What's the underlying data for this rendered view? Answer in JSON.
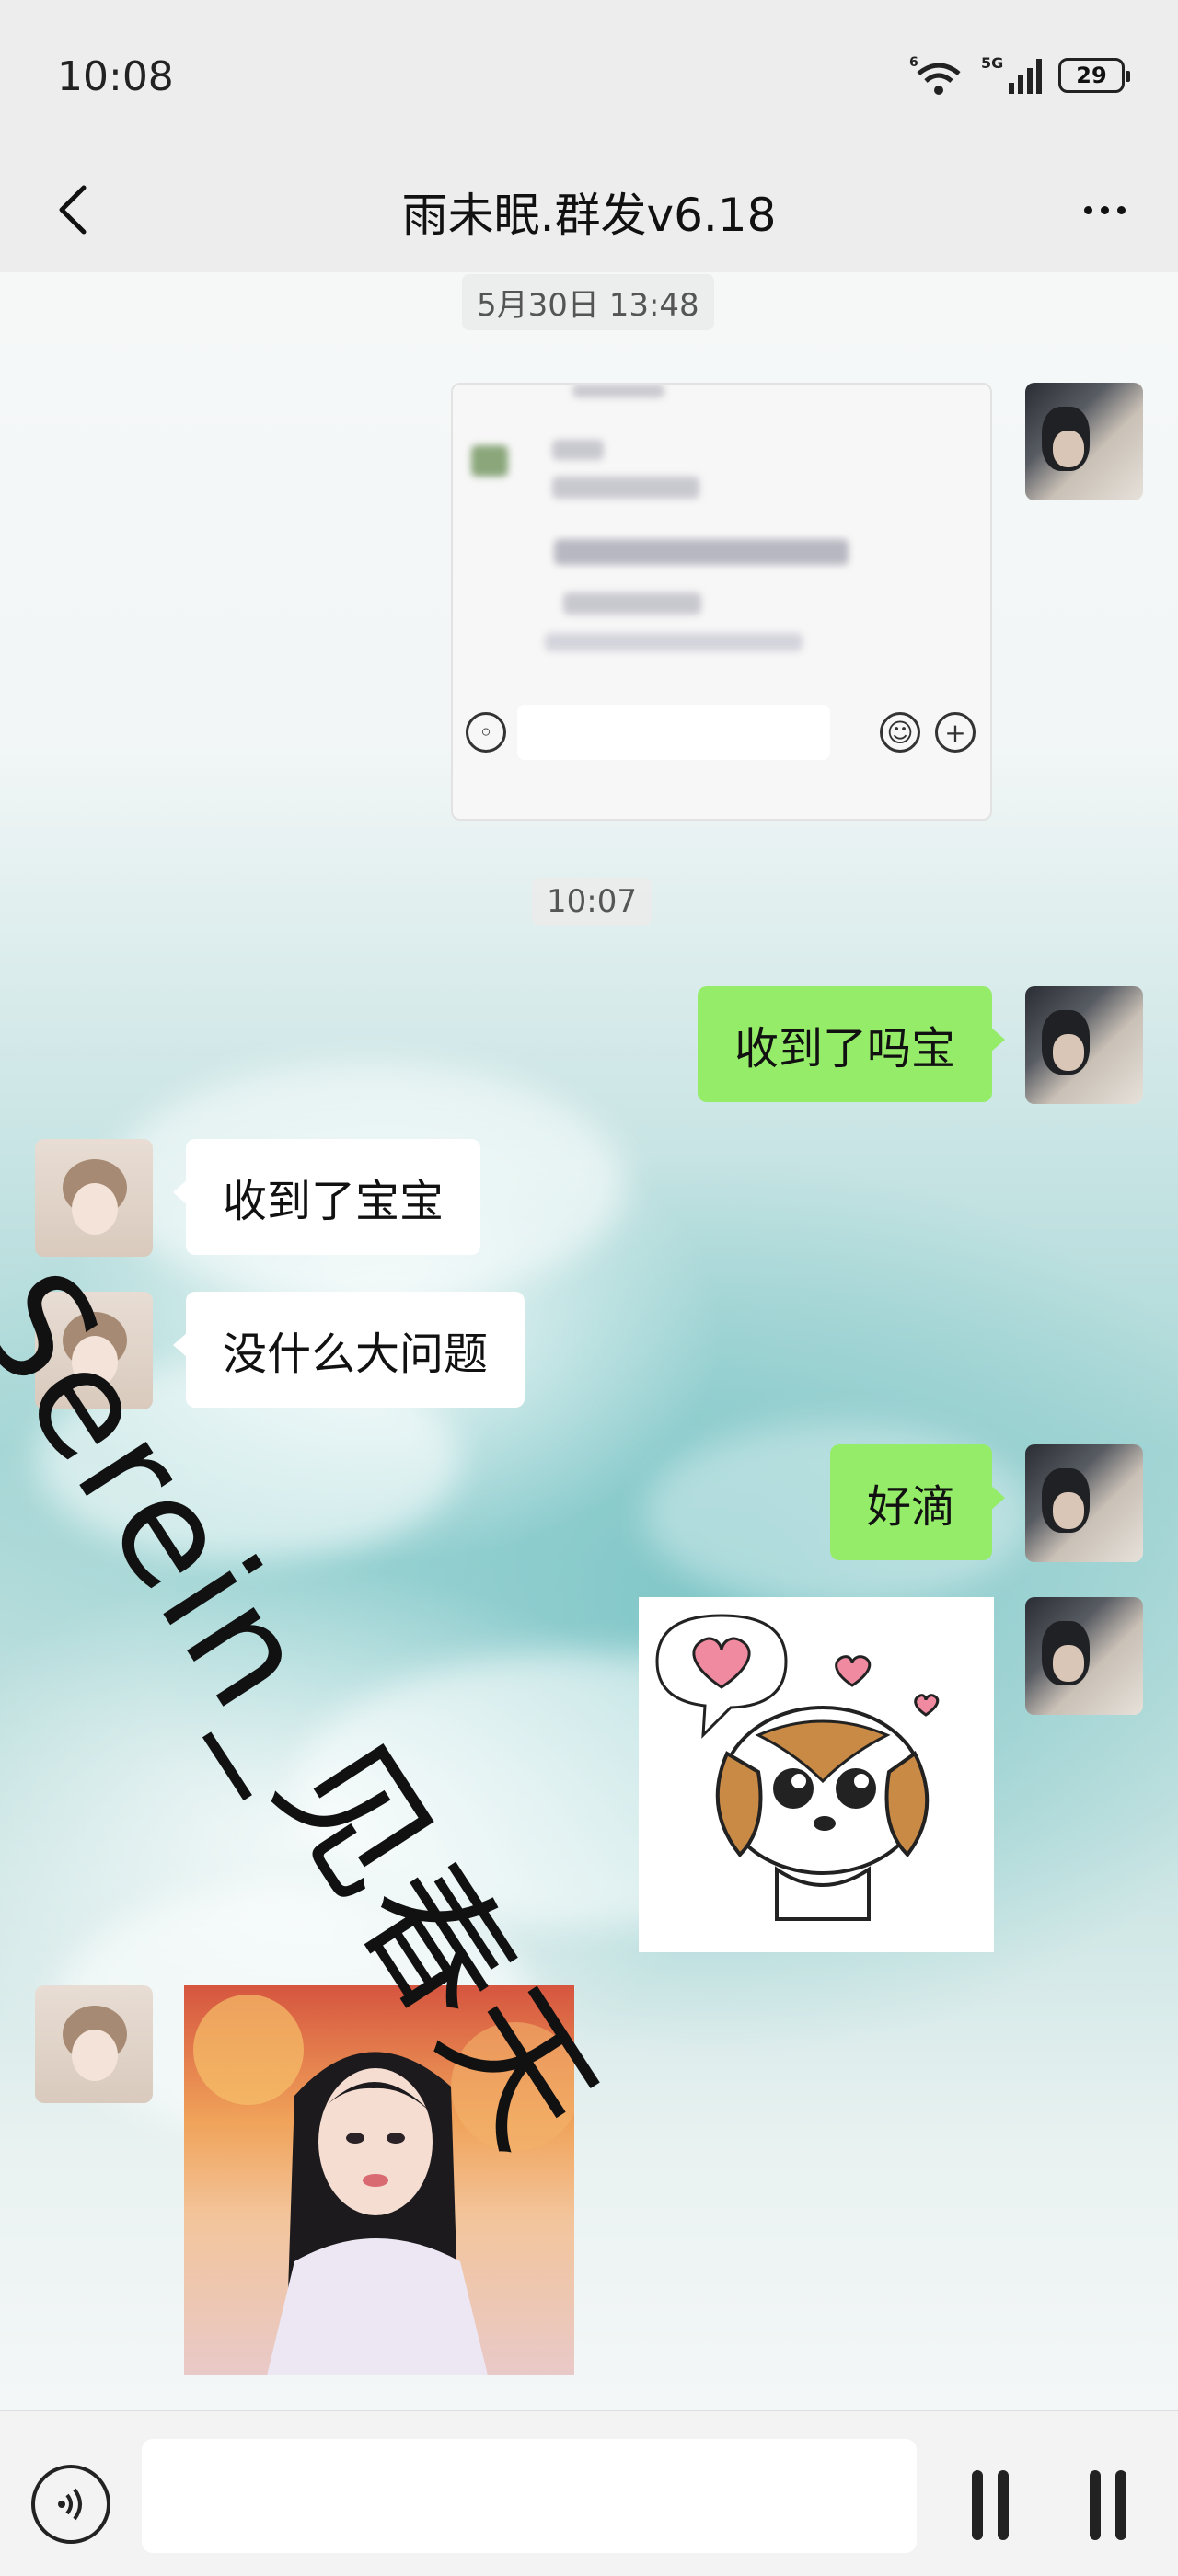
{
  "status_bar": {
    "time": "10:08",
    "wifi_label": "6",
    "network_label": "5G",
    "battery": "29"
  },
  "header": {
    "title": "雨未眠.群发v6.18",
    "back_icon": "chevron-left-icon",
    "more_icon": "more-horizontal-icon"
  },
  "messages": {
    "timestamp_1": "5月30日 13:48",
    "timestamp_2": "10:07",
    "m1": "收到了吗宝",
    "m2": "收到了宝宝",
    "m3": "没什么大问题",
    "m4": "好滴"
  },
  "watermark": "Serein_见春天",
  "colors": {
    "outgoing_bubble": "#95ec69",
    "incoming_bubble": "#ffffff",
    "bar_background": "#ededed"
  },
  "input": {
    "placeholder": "",
    "voice_icon": "voice-icon"
  }
}
